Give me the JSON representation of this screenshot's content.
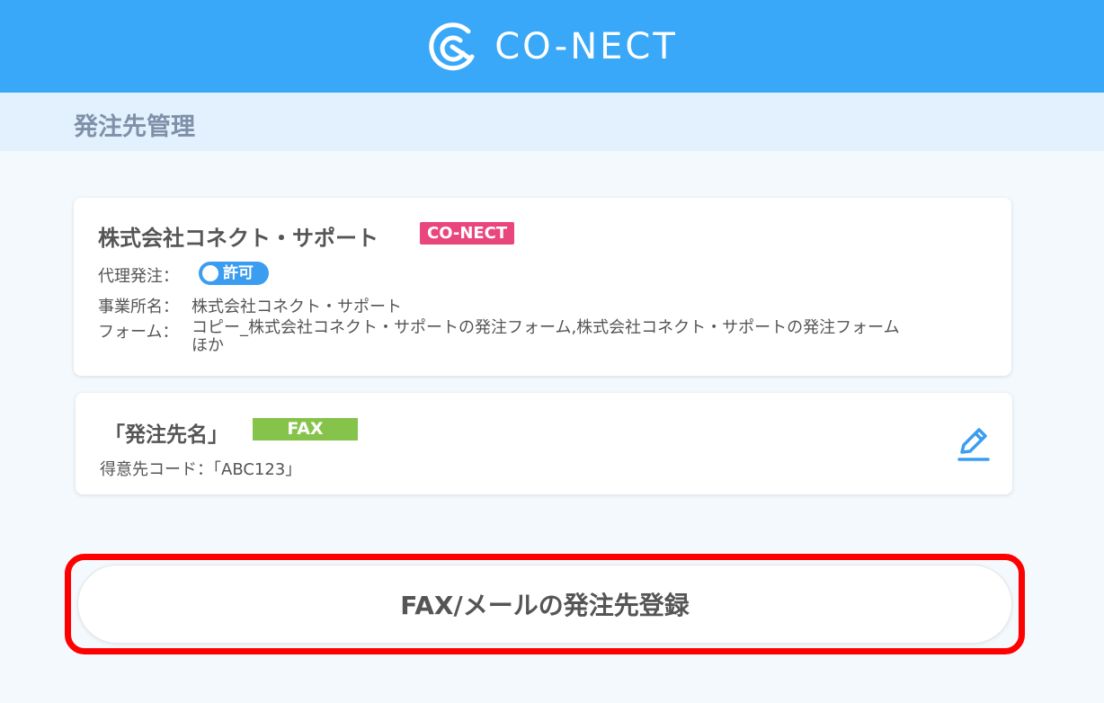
{
  "header": {
    "logo_text": "CO-NECT",
    "logo_icon": "conect-logo-icon"
  },
  "page": {
    "title": "発注先管理"
  },
  "company_card": {
    "name": "株式会社コネクト・サポート",
    "badge": "CO-NECT",
    "proxy_label": "代理発注：",
    "proxy_toggle": "許可",
    "office_label": "事業所名：",
    "office_value": "株式会社コネクト・サポート",
    "form_label": "フォーム：",
    "form_value": "コピー_株式会社コネクト・サポートの発注フォーム,株式会社コネクト・サポートの発注フォーム ほか"
  },
  "destination_card": {
    "name": "「発注先名」",
    "badge": "FAX",
    "client_code": "得意先コード：「ABC123」",
    "edit_icon": "pencil-icon"
  },
  "actions": {
    "register_label": "FAX/メールの発注先登録"
  },
  "colors": {
    "header_bg": "#39a8f8",
    "subheader_bg": "#e2f1fd",
    "conect_badge": "#e8467c",
    "fax_badge": "#86c34b",
    "toggle": "#3b9df0",
    "highlight": "#ff0000"
  }
}
